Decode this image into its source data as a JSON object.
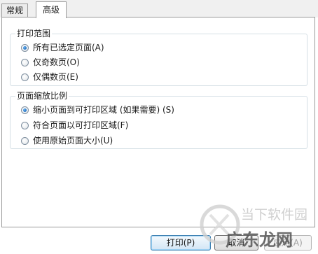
{
  "tabs": [
    {
      "label": "常规",
      "selected": false
    },
    {
      "label": "高级",
      "selected": true
    }
  ],
  "print_range": {
    "title": "打印范围",
    "options": [
      {
        "label": "所有已选定页面(A)",
        "checked": true
      },
      {
        "label": "仅奇数页(O)",
        "checked": false
      },
      {
        "label": "仅偶数页(E)",
        "checked": false
      }
    ]
  },
  "page_scaling": {
    "title": "页面缩放比例",
    "options": [
      {
        "label": "缩小页面到可打印区域 (如果需要) (S)",
        "checked": true
      },
      {
        "label": "符合页面以可打印区域(F)",
        "checked": false
      },
      {
        "label": "使用原始页面大小(U)",
        "checked": false
      }
    ]
  },
  "buttons": {
    "print": "打印(P)",
    "cancel": "取消",
    "apply": "应用(A)"
  },
  "watermark": {
    "line1": "当下软件园",
    "line2": "广东龙网"
  },
  "colors": {
    "accent": "#1f6fc2",
    "group_border": "#d5dfe5",
    "watermark": "#cfcfcf",
    "watermark_text": "#555555"
  }
}
